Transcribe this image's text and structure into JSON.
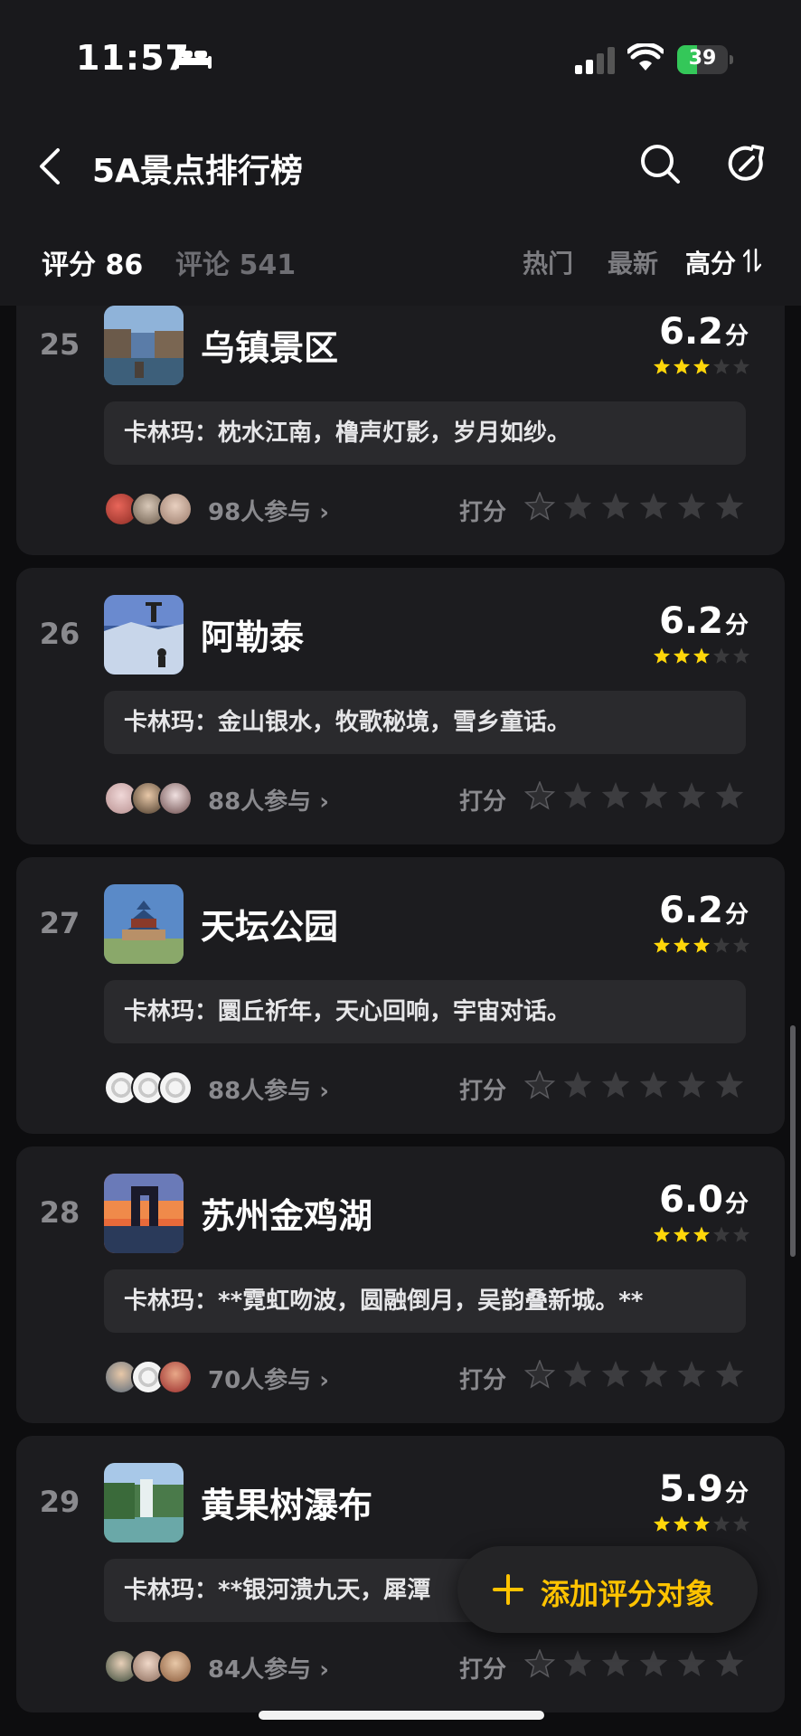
{
  "status_bar": {
    "time": "11:57",
    "battery": "39",
    "battery_level": 0.39
  },
  "header": {
    "title": "5A景点排行榜",
    "tabs": [
      {
        "label": "评分 86",
        "active": true
      },
      {
        "label": "评论 541",
        "active": false
      }
    ],
    "sort": [
      {
        "label": "热门",
        "active": false
      },
      {
        "label": "最新",
        "active": false
      },
      {
        "label": "高分",
        "active": true
      }
    ]
  },
  "items": [
    {
      "rank": "25",
      "name": "乌镇景区",
      "score": "6.2",
      "unit": "分",
      "stars": 3,
      "comment": "卡林玛：枕水江南，橹声灯影，岁月如纱。",
      "participants": "98人参与",
      "rate_label": "打分"
    },
    {
      "rank": "26",
      "name": "阿勒泰",
      "score": "6.2",
      "unit": "分",
      "stars": 3,
      "comment": "卡林玛：金山银水，牧歌秘境，雪乡童话。",
      "participants": "88人参与",
      "rate_label": "打分"
    },
    {
      "rank": "27",
      "name": "天坛公园",
      "score": "6.2",
      "unit": "分",
      "stars": 3,
      "comment": "卡林玛：圜丘祈年，天心回响，宇宙对话。",
      "participants": "88人参与",
      "rate_label": "打分"
    },
    {
      "rank": "28",
      "name": "苏州金鸡湖",
      "score": "6.0",
      "unit": "分",
      "stars": 3,
      "comment": "卡林玛：**霓虹吻波，圆融倒月，吴韵叠新城。**",
      "participants": "70人参与",
      "rate_label": "打分"
    },
    {
      "rank": "29",
      "name": "黄果树瀑布",
      "score": "5.9",
      "unit": "分",
      "stars": 3,
      "comment": "卡林玛：**银河溃九天，犀潭",
      "participants": "84人参与",
      "rate_label": "打分"
    }
  ],
  "fab": {
    "label": "添加评分对象"
  },
  "colors": {
    "accent": "#ffc300",
    "star_on": "#ffd60a",
    "star_off": "#3a3a3c",
    "battery": "#34c759"
  }
}
